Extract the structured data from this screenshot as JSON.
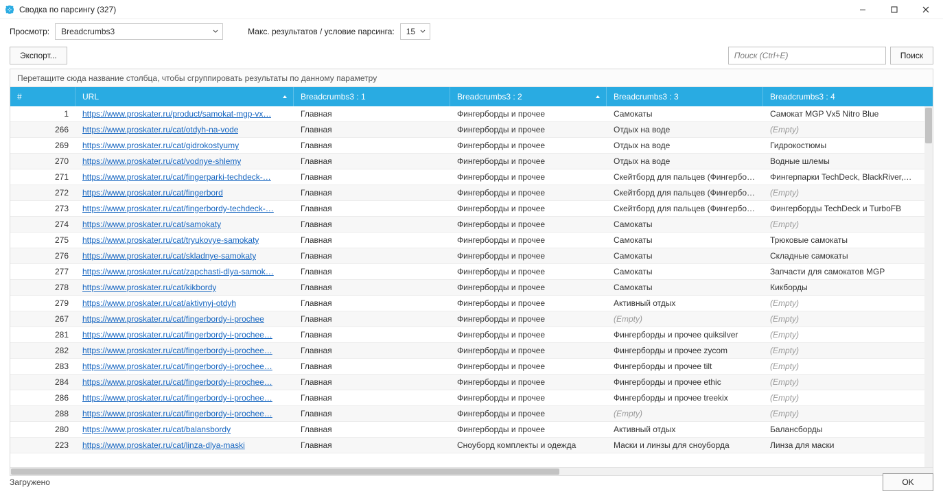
{
  "window": {
    "title": "Сводка по парсингу (327)"
  },
  "controls": {
    "view_label": "Просмотр:",
    "view_value": "Breadcrumbs3",
    "max_label": "Макс. результатов / условие парсинга:",
    "max_value": "15"
  },
  "toolbar": {
    "export_label": "Экспорт...",
    "search_placeholder": "Поиск (Ctrl+E)",
    "search_button": "Поиск"
  },
  "grid": {
    "group_hint": "Перетащите сюда название столбца, чтобы сгруппировать результаты по данному параметру",
    "columns": [
      {
        "key": "num",
        "label": "#"
      },
      {
        "key": "url",
        "label": "URL",
        "sort": "asc"
      },
      {
        "key": "bc1",
        "label": "Breadcrumbs3 : 1"
      },
      {
        "key": "bc2",
        "label": "Breadcrumbs3 : 2",
        "sort": "asc"
      },
      {
        "key": "bc3",
        "label": "Breadcrumbs3 : 3"
      },
      {
        "key": "bc4",
        "label": "Breadcrumbs3 : 4"
      }
    ],
    "rows": [
      {
        "num": "1",
        "url": "https://www.proskater.ru/product/samokat-mgp-vx…",
        "bc1": "Главная",
        "bc2": "Фингерборды и прочее",
        "bc3": "Самокаты",
        "bc4": "Самокат MGP Vx5 Nitro Blue"
      },
      {
        "num": "266",
        "url": "https://www.proskater.ru/cat/otdyh-na-vode",
        "bc1": "Главная",
        "bc2": "Фингерборды и прочее",
        "bc3": "Отдых на воде",
        "bc4": "(Empty)",
        "bc4_empty": true
      },
      {
        "num": "269",
        "url": "https://www.proskater.ru/cat/gidrokostyumy",
        "bc1": "Главная",
        "bc2": "Фингерборды и прочее",
        "bc3": "Отдых на воде",
        "bc4": "Гидрокостюмы"
      },
      {
        "num": "270",
        "url": "https://www.proskater.ru/cat/vodnye-shlemy",
        "bc1": "Главная",
        "bc2": "Фингерборды и прочее",
        "bc3": "Отдых на воде",
        "bc4": "Водные шлемы"
      },
      {
        "num": "271",
        "url": "https://www.proskater.ru/cat/fingerparki-techdeck-…",
        "bc1": "Главная",
        "bc2": "Фингерборды и прочее",
        "bc3": "Скейтборд для пальцев (Фингербо…",
        "bc4": "Фингерпарки TechDeck, BlackRiver,…"
      },
      {
        "num": "272",
        "url": "https://www.proskater.ru/cat/fingerbord",
        "bc1": "Главная",
        "bc2": "Фингерборды и прочее",
        "bc3": "Скейтборд для пальцев (Фингербо…",
        "bc4": "(Empty)",
        "bc4_empty": true
      },
      {
        "num": "273",
        "url": "https://www.proskater.ru/cat/fingerbordy-techdeck-…",
        "bc1": "Главная",
        "bc2": "Фингерборды и прочее",
        "bc3": "Скейтборд для пальцев (Фингербо…",
        "bc4": "Фингерборды TechDeck и TurboFB"
      },
      {
        "num": "274",
        "url": "https://www.proskater.ru/cat/samokaty",
        "bc1": "Главная",
        "bc2": "Фингерборды и прочее",
        "bc3": "Самокаты",
        "bc4": "(Empty)",
        "bc4_empty": true
      },
      {
        "num": "275",
        "url": "https://www.proskater.ru/cat/tryukovye-samokaty",
        "bc1": "Главная",
        "bc2": "Фингерборды и прочее",
        "bc3": "Самокаты",
        "bc4": "Трюковые самокаты"
      },
      {
        "num": "276",
        "url": "https://www.proskater.ru/cat/skladnye-samokaty",
        "bc1": "Главная",
        "bc2": "Фингерборды и прочее",
        "bc3": "Самокаты",
        "bc4": "Складные самокаты"
      },
      {
        "num": "277",
        "url": "https://www.proskater.ru/cat/zapchasti-dlya-samok…",
        "bc1": "Главная",
        "bc2": "Фингерборды и прочее",
        "bc3": "Самокаты",
        "bc4": "Запчасти для самокатов MGP"
      },
      {
        "num": "278",
        "url": "https://www.proskater.ru/cat/kikbordy",
        "bc1": "Главная",
        "bc2": "Фингерборды и прочее",
        "bc3": "Самокаты",
        "bc4": "Кикборды"
      },
      {
        "num": "279",
        "url": "https://www.proskater.ru/cat/aktivnyj-otdyh",
        "bc1": "Главная",
        "bc2": "Фингерборды и прочее",
        "bc3": "Активный отдых",
        "bc4": "(Empty)",
        "bc4_empty": true
      },
      {
        "num": "267",
        "url": "https://www.proskater.ru/cat/fingerbordy-i-prochee",
        "bc1": "Главная",
        "bc2": "Фингерборды и прочее",
        "bc3": "(Empty)",
        "bc3_empty": true,
        "bc4": "(Empty)",
        "bc4_empty": true
      },
      {
        "num": "281",
        "url": "https://www.proskater.ru/cat/fingerbordy-i-prochee…",
        "bc1": "Главная",
        "bc2": "Фингерборды и прочее",
        "bc3": "Фингерборды и прочее quiksilver",
        "bc4": "(Empty)",
        "bc4_empty": true
      },
      {
        "num": "282",
        "url": "https://www.proskater.ru/cat/fingerbordy-i-prochee…",
        "bc1": "Главная",
        "bc2": "Фингерборды и прочее",
        "bc3": "Фингерборды и прочее zycom",
        "bc4": "(Empty)",
        "bc4_empty": true
      },
      {
        "num": "283",
        "url": "https://www.proskater.ru/cat/fingerbordy-i-prochee…",
        "bc1": "Главная",
        "bc2": "Фингерборды и прочее",
        "bc3": "Фингерборды и прочее tilt",
        "bc4": "(Empty)",
        "bc4_empty": true
      },
      {
        "num": "284",
        "url": "https://www.proskater.ru/cat/fingerbordy-i-prochee…",
        "bc1": "Главная",
        "bc2": "Фингерборды и прочее",
        "bc3": "Фингерборды и прочее ethic",
        "bc4": "(Empty)",
        "bc4_empty": true
      },
      {
        "num": "286",
        "url": "https://www.proskater.ru/cat/fingerbordy-i-prochee…",
        "bc1": "Главная",
        "bc2": "Фингерборды и прочее",
        "bc3": "Фингерборды и прочее treekix",
        "bc4": "(Empty)",
        "bc4_empty": true
      },
      {
        "num": "288",
        "url": "https://www.proskater.ru/cat/fingerbordy-i-prochee…",
        "bc1": "Главная",
        "bc2": "Фингерборды и прочее",
        "bc3": "(Empty)",
        "bc3_empty": true,
        "bc4": "(Empty)",
        "bc4_empty": true
      },
      {
        "num": "280",
        "url": "https://www.proskater.ru/cat/balansbordy",
        "bc1": "Главная",
        "bc2": "Фингерборды и прочее",
        "bc3": "Активный отдых",
        "bc4": "Балансборды"
      },
      {
        "num": "223",
        "url": "https://www.proskater.ru/cat/linza-dlya-maski",
        "bc1": "Главная",
        "bc2": "Сноуборд комплекты и одежда",
        "bc3": "Маски и линзы для сноуборда",
        "bc4": "Линза для маски"
      }
    ]
  },
  "status": {
    "text": "Загружено"
  },
  "buttons": {
    "ok": "OK"
  }
}
